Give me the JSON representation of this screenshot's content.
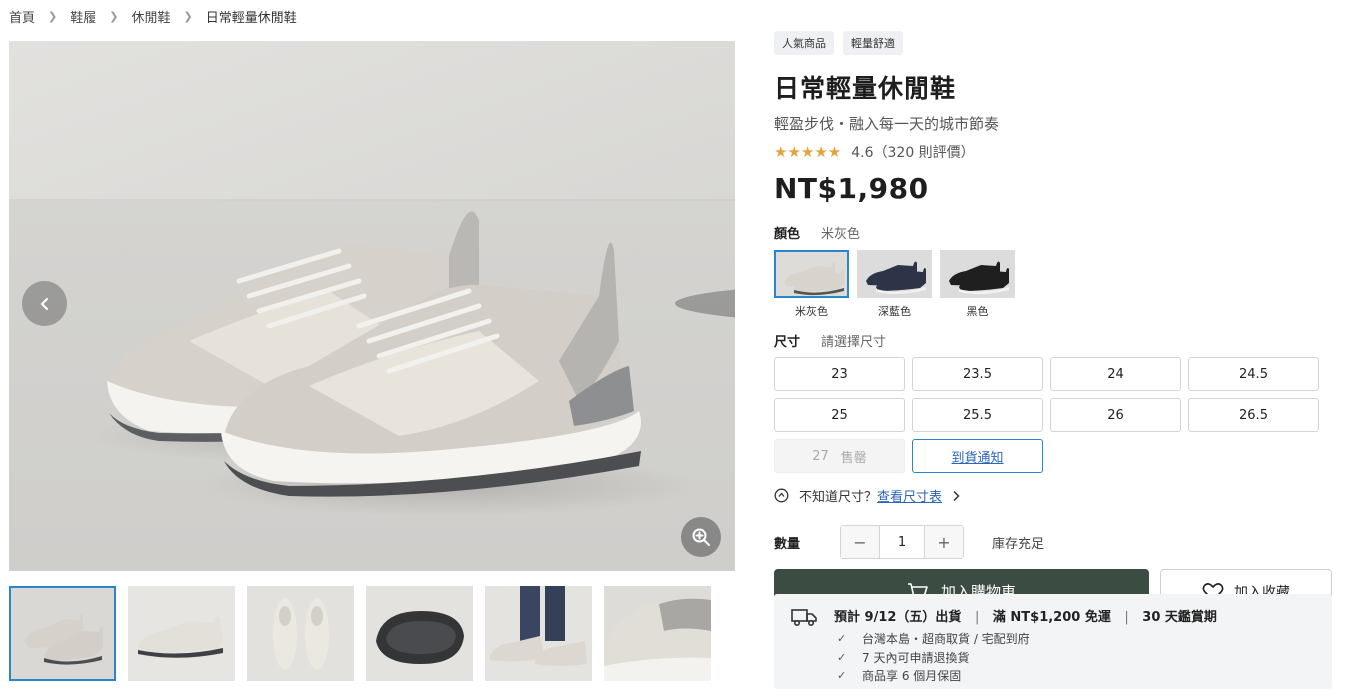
{
  "breadcrumb": [
    "首頁",
    "鞋履",
    "休閒鞋",
    "日常輕量休閒鞋"
  ],
  "product": {
    "tags": [
      "人氣商品",
      "輕量舒適"
    ],
    "title": "日常輕量休閒鞋",
    "subtitle": "輕盈步伐・融入每一天的城市節奏",
    "rating": 4.6,
    "rating_text": "4.6（320 則評價）",
    "price": "NT$1,980"
  },
  "color": {
    "label": "顏色",
    "selected": "米灰色",
    "options": [
      {
        "name": "米灰色",
        "shoe": "#d8d4cc",
        "sole": "#f4f3f0",
        "bg": "#dedcd9"
      },
      {
        "name": "深藍色",
        "shoe": "#2d3448",
        "sole": "#f0f0f0",
        "bg": "#dcdcdc"
      },
      {
        "name": "黑色",
        "shoe": "#1f1f1f",
        "sole": "#f2f2f2",
        "bg": "#dcdcdc"
      }
    ]
  },
  "size": {
    "label": "尺寸",
    "prompt": "請選擇尺寸",
    "options": [
      "23",
      "23.5",
      "24",
      "24.5",
      "25",
      "25.5",
      "26",
      "26.5"
    ],
    "soldout_size": "27",
    "soldout_label": "售罄",
    "notify_label": "到貨通知",
    "guide_prefix": "不知道尺寸？",
    "guide_link": "查看尺寸表"
  },
  "quantity": {
    "label": "數量",
    "value": "1",
    "minus": "−",
    "plus": "+",
    "stock": "庫存充足"
  },
  "actions": {
    "add_cart": "加入購物車",
    "add_fav": "加入收藏"
  },
  "shipping": {
    "eta": "預計 9/12（五）出貨",
    "free": "滿 NT$1,200 免運",
    "trial": "30 天鑑賞期",
    "divider": "|",
    "points": [
      "台灣本島・超商取貨 / 宅配到府",
      "7 天內可申請退換貨",
      "商品享 6 個月保固"
    ]
  },
  "colors_ui": {
    "accent": "#2a86c8",
    "cart_bg": "#3b4c43",
    "star": "#e6a23c"
  }
}
